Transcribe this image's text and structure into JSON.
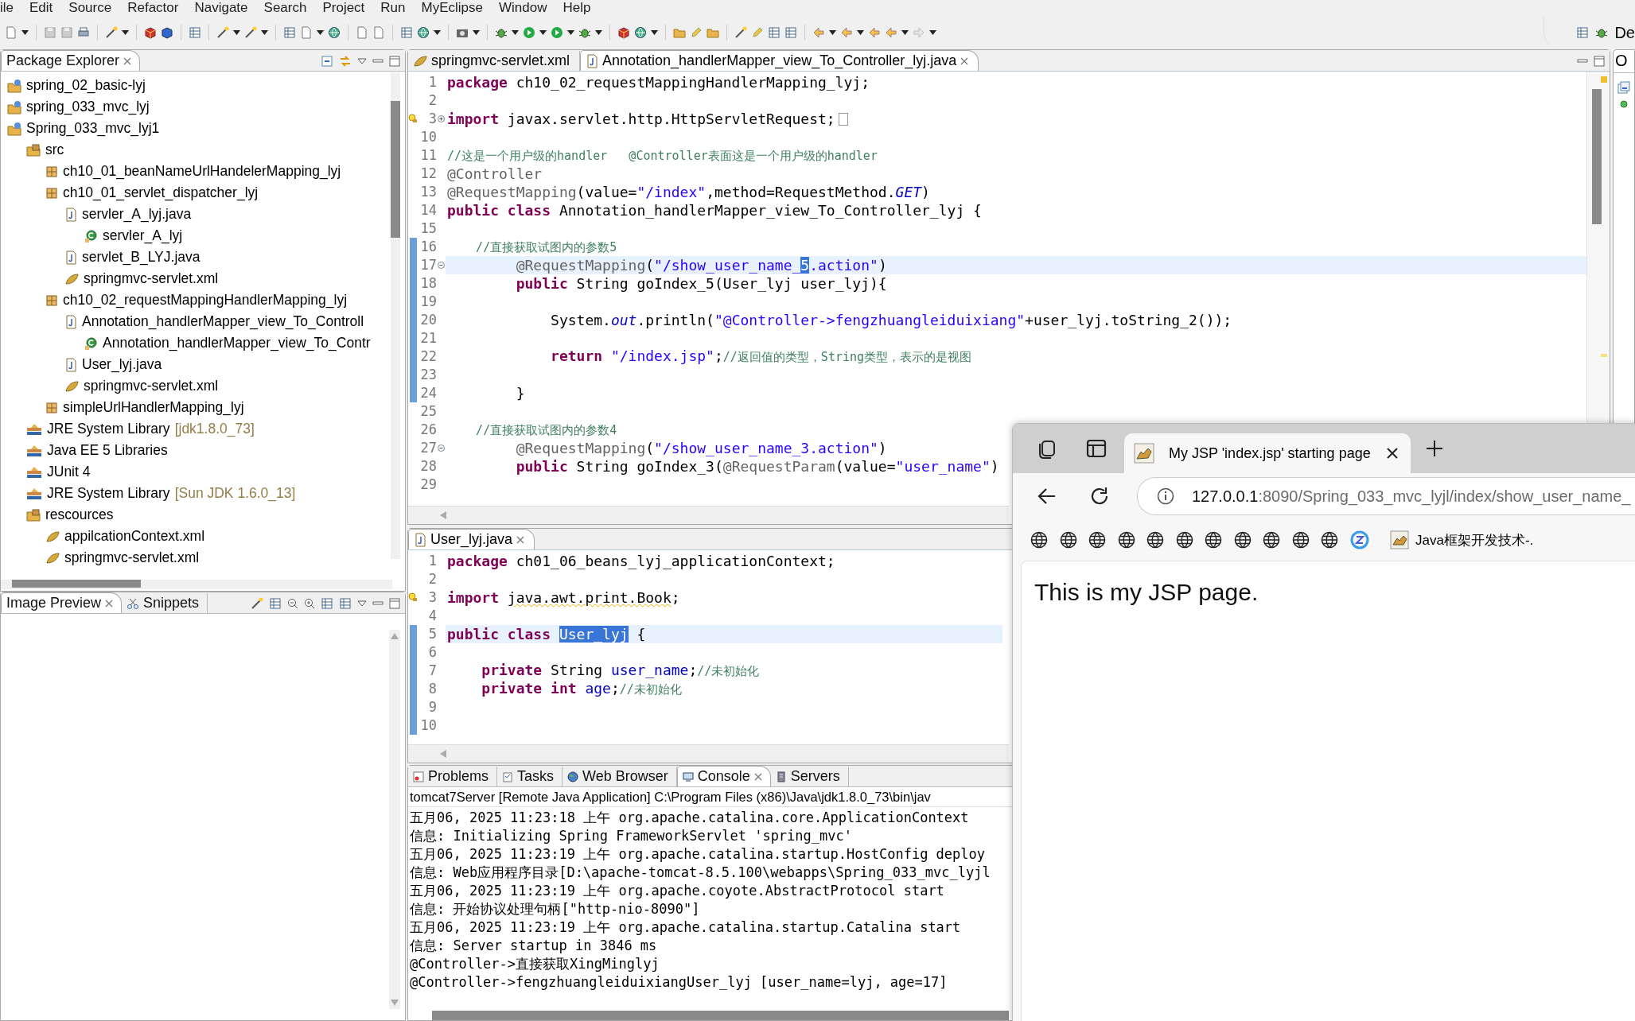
{
  "menu": [
    "ile",
    "Edit",
    "Source",
    "Refactor",
    "Navigate",
    "Search",
    "Project",
    "Run",
    "MyEclipse",
    "Window",
    "Help"
  ],
  "perspective": {
    "label": "De"
  },
  "package_explorer": {
    "title": "Package Explorer",
    "items": [
      {
        "kind": "project",
        "label": "spring_02_basic-lyj"
      },
      {
        "kind": "project",
        "label": "spring_033_mvc_lyj"
      },
      {
        "kind": "project",
        "label": "Spring_033_mvc_lyj1",
        "children": [
          {
            "kind": "source",
            "label": "src",
            "children": [
              {
                "kind": "package",
                "label": "ch10_01_beanNameUrlHandelerMapping_lyj"
              },
              {
                "kind": "package",
                "label": "ch10_01_servlet_dispatcher_lyj",
                "children": [
                  {
                    "kind": "java",
                    "label": "servler_A_lyj.java",
                    "children": [
                      {
                        "kind": "class",
                        "label": "servler_A_lyj"
                      }
                    ]
                  },
                  {
                    "kind": "java",
                    "label": "servlet_B_LYJ.java"
                  },
                  {
                    "kind": "xml",
                    "label": "springmvc-servlet.xml"
                  }
                ]
              },
              {
                "kind": "package",
                "label": "ch10_02_requestMappingHandlerMapping_lyj",
                "children": [
                  {
                    "kind": "java",
                    "label": "Annotation_handlerMapper_view_To_Controll",
                    "children": [
                      {
                        "kind": "class",
                        "label": "Annotation_handlerMapper_view_To_Contr"
                      }
                    ]
                  },
                  {
                    "kind": "java",
                    "label": "User_lyj.java"
                  },
                  {
                    "kind": "xml",
                    "label": "springmvc-servlet.xml"
                  }
                ]
              },
              {
                "kind": "package",
                "label": "simpleUrlHandlerMapping_lyj"
              }
            ]
          },
          {
            "kind": "library",
            "label": "JRE System Library",
            "detail": "[jdk1.8.0_73]"
          },
          {
            "kind": "library",
            "label": "Java EE 5 Libraries"
          },
          {
            "kind": "library",
            "label": "JUnit 4"
          },
          {
            "kind": "library",
            "label": "JRE System Library",
            "detail": "[Sun JDK 1.6.0_13]"
          },
          {
            "kind": "source",
            "label": "rescources",
            "children": [
              {
                "kind": "xml",
                "label": "appilcationContext.xml"
              },
              {
                "kind": "xml",
                "label": "springmvc-servlet.xml"
              }
            ]
          }
        ]
      }
    ]
  },
  "preview_panel": {
    "tabs": [
      {
        "label": "Image Preview",
        "selected": true
      },
      {
        "label": "Snippets",
        "selected": false
      }
    ]
  },
  "editor": {
    "tabs": [
      {
        "kind": "xml",
        "label": "springmvc-servlet.xml",
        "selected": false
      },
      {
        "kind": "java",
        "label": "Annotation_handlerMapper_view_To_Controller_lyj.java",
        "selected": true
      }
    ],
    "lines": [
      {
        "n": "1",
        "kind": "plain",
        "current": false,
        "changed": false,
        "warning": false,
        "segments": [
          {
            "kind": "kw",
            "text": "package"
          },
          {
            "kind": "plain",
            "text": " ch10_02_requestMappingHandlerMapping_lyj;"
          }
        ]
      },
      {
        "n": "2",
        "kind": "plain",
        "current": false,
        "changed": false,
        "warning": false
      },
      {
        "n": "3",
        "kind": "fold_closed",
        "current": false,
        "changed": false,
        "warning": true,
        "segments": [
          {
            "kind": "kw",
            "text": "import"
          },
          {
            "kind": "plain",
            "text": " javax.servlet.http.HttpServletRequest;"
          }
        ]
      },
      {
        "n": "10",
        "kind": "plain",
        "current": false,
        "changed": false,
        "warning": false
      },
      {
        "n": "11",
        "kind": "plain",
        "current": false,
        "changed": false,
        "warning": false,
        "segments": [
          {
            "kind": "com",
            "text": "//这是一个用户级的handler   @Controller表面这是一个用户级的handler"
          }
        ]
      },
      {
        "n": "12",
        "kind": "plain",
        "current": false,
        "changed": false,
        "warning": false,
        "segments": [
          {
            "kind": "ann",
            "text": "@Controller"
          }
        ]
      },
      {
        "n": "13",
        "kind": "plain",
        "current": false,
        "changed": false,
        "warning": false,
        "segments": [
          {
            "kind": "ann",
            "text": "@RequestMapping"
          },
          {
            "kind": "plain",
            "text": "(value="
          },
          {
            "kind": "str",
            "text": "\"/index\""
          },
          {
            "kind": "plain",
            "text": ",method=RequestMethod."
          },
          {
            "kind": "static",
            "text": "GET"
          },
          {
            "kind": "plain",
            "text": ")"
          }
        ]
      },
      {
        "n": "14",
        "kind": "plain",
        "current": false,
        "changed": false,
        "warning": false,
        "segments": [
          {
            "kind": "kw",
            "text": "public class"
          },
          {
            "kind": "plain",
            "text": " Annotation_handlerMapper_view_To_Controller_lyj {"
          }
        ]
      },
      {
        "n": "15",
        "kind": "plain",
        "current": false,
        "changed": false,
        "warning": false
      },
      {
        "n": "16",
        "kind": "plain",
        "current": false,
        "changed": true,
        "warning": false,
        "segments": [
          {
            "kind": "com",
            "text": "    //直接获取试图内的参数5"
          }
        ]
      },
      {
        "n": "17",
        "kind": "fold_open",
        "current": true,
        "changed": true,
        "warning": false,
        "segments": [
          {
            "kind": "ann",
            "text": "        @RequestMapping"
          },
          {
            "kind": "plain",
            "text": "("
          },
          {
            "kind": "str",
            "text": "\"/show_user_name_"
          },
          {
            "kind": "sel",
            "text": "5"
          },
          {
            "kind": "str",
            "text": ".action\""
          },
          {
            "kind": "plain",
            "text": ")"
          }
        ]
      },
      {
        "n": "18",
        "kind": "plain",
        "current": false,
        "changed": true,
        "warning": false,
        "segments": [
          {
            "kind": "kw",
            "text": "        public"
          },
          {
            "kind": "plain",
            "text": " String goIndex_5(User_lyj user_lyj){"
          }
        ]
      },
      {
        "n": "19",
        "kind": "plain",
        "current": false,
        "changed": true,
        "warning": false
      },
      {
        "n": "20",
        "kind": "plain",
        "current": false,
        "changed": true,
        "warning": false,
        "segments": [
          {
            "kind": "plain",
            "text": "            System."
          },
          {
            "kind": "static",
            "text": "out"
          },
          {
            "kind": "plain",
            "text": ".println("
          },
          {
            "kind": "str",
            "text": "\"@Controller->fengzhuangleiduixiang\""
          },
          {
            "kind": "plain",
            "text": "+user_lyj.toString_2());"
          }
        ]
      },
      {
        "n": "21",
        "kind": "plain",
        "current": false,
        "changed": true,
        "warning": false
      },
      {
        "n": "22",
        "kind": "plain",
        "current": false,
        "changed": true,
        "warning": false,
        "segments": [
          {
            "kind": "kw",
            "text": "            return"
          },
          {
            "kind": "str",
            "text": " \"/index.jsp\""
          },
          {
            "kind": "plain",
            "text": ";"
          },
          {
            "kind": "com",
            "text": "//返回值的类型，String类型，表示的是视图"
          }
        ]
      },
      {
        "n": "23",
        "kind": "plain",
        "current": false,
        "changed": true,
        "warning": false
      },
      {
        "n": "24",
        "kind": "plain",
        "current": false,
        "changed": true,
        "warning": false,
        "segments": [
          {
            "kind": "plain",
            "text": "        }"
          }
        ]
      },
      {
        "n": "25",
        "kind": "plain",
        "current": false,
        "changed": false,
        "warning": false
      },
      {
        "n": "26",
        "kind": "plain",
        "current": false,
        "changed": false,
        "warning": false,
        "segments": [
          {
            "kind": "com",
            "text": "    //直接获取试图内的参数4"
          }
        ]
      },
      {
        "n": "27",
        "kind": "fold_open",
        "current": false,
        "changed": false,
        "warning": false,
        "segments": [
          {
            "kind": "ann",
            "text": "        @RequestMapping"
          },
          {
            "kind": "plain",
            "text": "("
          },
          {
            "kind": "str",
            "text": "\"/show_user_name_3.action\""
          },
          {
            "kind": "plain",
            "text": ")"
          }
        ]
      },
      {
        "n": "28",
        "kind": "plain",
        "current": false,
        "changed": false,
        "warning": false,
        "segments": [
          {
            "kind": "kw",
            "text": "        public"
          },
          {
            "kind": "plain",
            "text": " String goIndex_3("
          },
          {
            "kind": "ann",
            "text": "@RequestParam"
          },
          {
            "kind": "plain",
            "text": "(value="
          },
          {
            "kind": "str",
            "text": "\"user_name\""
          },
          {
            "kind": "plain",
            "text": ")"
          }
        ]
      },
      {
        "n": "29",
        "kind": "plain",
        "current": false,
        "changed": false,
        "warning": false
      }
    ]
  },
  "editor_2": {
    "tabs": [
      {
        "kind": "java",
        "label": "User_lyj.java",
        "selected": true
      }
    ],
    "lines": [
      {
        "n": "1",
        "current": false,
        "changed": false,
        "warning": false,
        "segments": [
          {
            "kind": "kw",
            "text": "package"
          },
          {
            "kind": "plain",
            "text": " ch01_06_beans_lyj_applicationContext;"
          }
        ]
      },
      {
        "n": "2",
        "current": false,
        "changed": false,
        "warning": false
      },
      {
        "n": "3",
        "current": false,
        "changed": false,
        "warning": true,
        "segments": [
          {
            "kind": "kw",
            "text": "import "
          },
          {
            "kind": "warn",
            "text": "java.awt.print.Book"
          },
          {
            "kind": "plain",
            "text": ";"
          }
        ]
      },
      {
        "n": "4",
        "current": false,
        "changed": false,
        "warning": false
      },
      {
        "n": "5",
        "current": true,
        "changed": true,
        "warning": false,
        "segments": [
          {
            "kind": "kw",
            "text": "public class "
          },
          {
            "kind": "sel",
            "text": "User_lyj"
          },
          {
            "kind": "plain",
            "text": " {"
          }
        ]
      },
      {
        "n": "6",
        "current": false,
        "changed": true,
        "warning": false
      },
      {
        "n": "7",
        "current": false,
        "changed": true,
        "warning": false,
        "segments": [
          {
            "kind": "kw",
            "text": "    private"
          },
          {
            "kind": "plain",
            "text": " String "
          },
          {
            "kind": "field",
            "text": "user_name"
          },
          {
            "kind": "plain",
            "text": ";"
          },
          {
            "kind": "com",
            "text": "//未初始化"
          }
        ]
      },
      {
        "n": "8",
        "current": false,
        "changed": true,
        "warning": false,
        "segments": [
          {
            "kind": "kw",
            "text": "    private int"
          },
          {
            "kind": "field",
            "text": " age"
          },
          {
            "kind": "plain",
            "text": ";"
          },
          {
            "kind": "com",
            "text": "//未初始化"
          }
        ]
      },
      {
        "n": "9",
        "current": false,
        "changed": true,
        "warning": false
      },
      {
        "n": "10",
        "current": false,
        "changed": true,
        "warning": false
      }
    ]
  },
  "console": {
    "tabs": [
      {
        "kind": "problems",
        "label": "Problems",
        "selected": false
      },
      {
        "kind": "tasks",
        "label": "Tasks",
        "selected": false
      },
      {
        "kind": "web",
        "label": "Web Browser",
        "selected": false
      },
      {
        "kind": "console",
        "label": "Console",
        "selected": true
      },
      {
        "kind": "servers",
        "label": "Servers",
        "selected": false
      }
    ],
    "header": "tomcat7Server [Remote Java Application] C:\\Program Files (x86)\\Java\\jdk1.8.0_73\\bin\\jav",
    "lines": [
      "五月06, 2025 11:23:18 上午 org.apache.catalina.core.ApplicationContext",
      "信息: Initializing Spring FrameworkServlet 'spring_mvc'",
      "五月06, 2025 11:23:19 上午 org.apache.catalina.startup.HostConfig deploy",
      "信息: Web应用程序目录[D:\\apache-tomcat-8.5.100\\webapps\\Spring_033_mvc_lyjl",
      "五月06, 2025 11:23:19 上午 org.apache.coyote.AbstractProtocol start",
      "信息: 开始协议处理句柄[\"http-nio-8090\"]",
      "五月06, 2025 11:23:19 上午 org.apache.catalina.startup.Catalina start",
      "信息: Server startup in 3846 ms",
      "@Controller->直接获取XingMinglyj",
      "@Controller->fengzhuangleiduixiangUser_lyj [user_name=lyj, age=17]"
    ]
  },
  "side_panel": {
    "label": "O"
  },
  "browser": {
    "tab_title": "My JSP 'index.jsp' starting page",
    "url_host": "127.0.0.1",
    "url_path": ":8090/Spring_033_mvc_lyjl/index/show_user_name_",
    "bookmark_label": "Java框架开发技术-.",
    "page_text": "This is my JSP page."
  }
}
